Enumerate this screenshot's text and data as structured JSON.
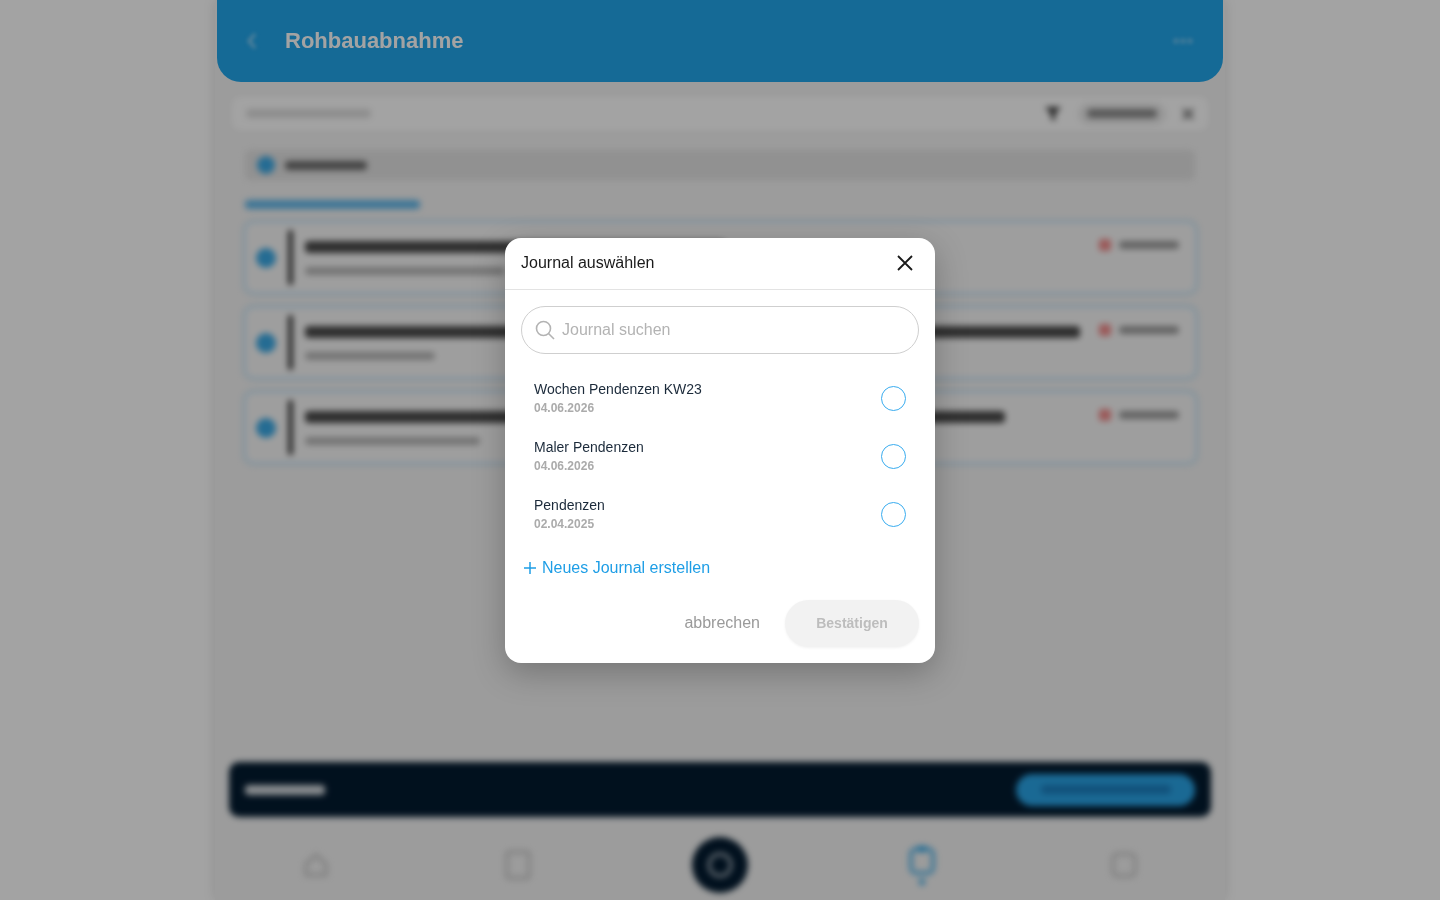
{
  "app": {
    "title": "Rohbauabnahme",
    "select_all": {
      "checked": true
    },
    "tasks": [
      {
        "checked": true
      },
      {
        "checked": true
      },
      {
        "checked": true
      }
    ],
    "bottom_nav": [
      {
        "kind": "home",
        "selected": false
      },
      {
        "kind": "page",
        "selected": false
      },
      {
        "kind": "action",
        "selected": false
      },
      {
        "kind": "journal",
        "selected": true
      },
      {
        "kind": "square",
        "selected": false
      }
    ]
  },
  "dialog": {
    "title": "Journal auswählen",
    "search": {
      "placeholder": "Journal suchen"
    },
    "journals": [
      {
        "name": "Wochen Pendenzen KW23",
        "date": "04.06.2026",
        "selected": false
      },
      {
        "name": "Maler Pendenzen",
        "date": "04.06.2026",
        "selected": false
      },
      {
        "name": "Pendenzen",
        "date": "02.04.2025",
        "selected": false
      }
    ],
    "create_link": "Neues Journal erstellen",
    "cancel": "abbrechen",
    "confirm": {
      "label": "Bestätigen",
      "disabled": true
    }
  }
}
